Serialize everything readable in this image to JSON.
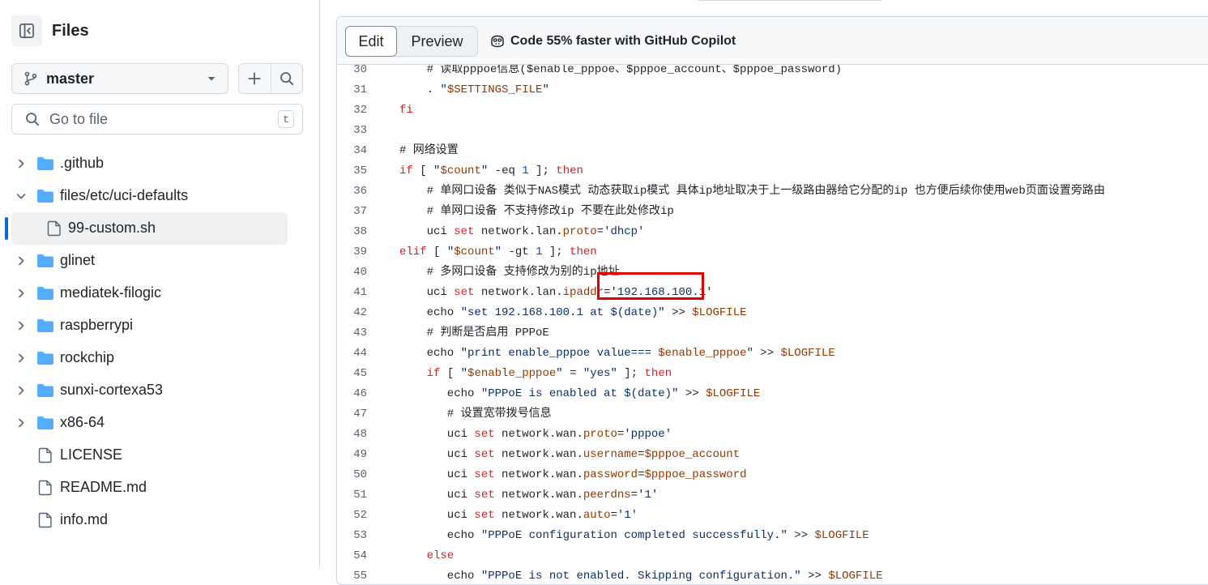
{
  "sidebar": {
    "title": "Files",
    "branch": "master",
    "goto_placeholder": "Go to file",
    "goto_shortcut": "t",
    "tree": [
      {
        "type": "dir",
        "label": ".github",
        "expanded": false,
        "indent": 0
      },
      {
        "type": "dir",
        "label": "files/etc/uci-defaults",
        "expanded": true,
        "indent": 0
      },
      {
        "type": "file",
        "label": "99-custom.sh",
        "selected": true,
        "indent": 1
      },
      {
        "type": "dir",
        "label": "glinet",
        "expanded": false,
        "indent": 0
      },
      {
        "type": "dir",
        "label": "mediatek-filogic",
        "expanded": false,
        "indent": 0
      },
      {
        "type": "dir",
        "label": "raspberrypi",
        "expanded": false,
        "indent": 0
      },
      {
        "type": "dir",
        "label": "rockchip",
        "expanded": false,
        "indent": 0
      },
      {
        "type": "dir",
        "label": "sunxi-cortexa53",
        "expanded": false,
        "indent": 0
      },
      {
        "type": "dir",
        "label": "x86-64",
        "expanded": false,
        "indent": 0
      },
      {
        "type": "file",
        "label": "LICENSE",
        "indent": 0
      },
      {
        "type": "file",
        "label": "README.md",
        "indent": 0
      },
      {
        "type": "file",
        "label": "info.md",
        "indent": 0
      }
    ]
  },
  "editor": {
    "tab_edit": "Edit",
    "tab_preview": "Preview",
    "copilot_text": "Code 55% faster with GitHub Copilot",
    "highlighted_value": "'192.168.100.1'"
  },
  "colors": {
    "accent": "#0969da",
    "folder": "#54aeff",
    "highlight_border": "#e00000"
  },
  "code_lines": [
    {
      "n": "30",
      "segs": [
        [
          "    ",
          "t"
        ],
        [
          "# 读取pppoe信息($enable_pppoe、$pppoe_account、$pppoe_password)",
          "cm"
        ]
      ]
    },
    {
      "n": "31",
      "segs": [
        [
          "    . ",
          "t"
        ],
        [
          "\"",
          "str"
        ],
        [
          "$SETTINGS_FILE",
          "var"
        ],
        [
          "\"",
          "str"
        ]
      ]
    },
    {
      "n": "32",
      "segs": [
        [
          "fi",
          "kw"
        ]
      ]
    },
    {
      "n": "33",
      "segs": [
        [
          "",
          "t"
        ]
      ]
    },
    {
      "n": "34",
      "segs": [
        [
          "# 网络设置",
          "cm"
        ]
      ]
    },
    {
      "n": "35",
      "segs": [
        [
          "if",
          "kw"
        ],
        [
          " [ ",
          "t"
        ],
        [
          "\"",
          "str"
        ],
        [
          "$count",
          "var"
        ],
        [
          "\"",
          "str"
        ],
        [
          " -eq ",
          "t"
        ],
        [
          "1",
          "ptn"
        ],
        [
          " ]; ",
          "t"
        ],
        [
          "then",
          "kw"
        ]
      ]
    },
    {
      "n": "36",
      "segs": [
        [
          "    # 单网口设备 类似于NAS模式 动态获取ip模式 具体ip地址取决于上一级路由器给它分配的ip 也方便后续你使用web页面设置旁路由",
          "cm"
        ]
      ]
    },
    {
      "n": "37",
      "segs": [
        [
          "    # 单网口设备 不支持修改ip 不要在此处修改ip",
          "cm"
        ]
      ]
    },
    {
      "n": "38",
      "segs": [
        [
          "    uci ",
          "t"
        ],
        [
          "set",
          "kw"
        ],
        [
          " network.lan.",
          "t"
        ],
        [
          "proto",
          "var"
        ],
        [
          "=",
          "t"
        ],
        [
          "'dhcp'",
          "str"
        ]
      ]
    },
    {
      "n": "39",
      "segs": [
        [
          "elif",
          "kw"
        ],
        [
          " [ ",
          "t"
        ],
        [
          "\"",
          "str"
        ],
        [
          "$count",
          "var"
        ],
        [
          "\"",
          "str"
        ],
        [
          " -gt ",
          "t"
        ],
        [
          "1",
          "ptn"
        ],
        [
          " ]; ",
          "t"
        ],
        [
          "then",
          "kw"
        ]
      ]
    },
    {
      "n": "40",
      "segs": [
        [
          "    # 多网口设备 支持修改为别的ip地址",
          "cm"
        ]
      ]
    },
    {
      "n": "41",
      "segs": [
        [
          "    uci ",
          "t"
        ],
        [
          "set",
          "kw"
        ],
        [
          " network.lan.",
          "t"
        ],
        [
          "ipaddr",
          "var"
        ],
        [
          "=",
          "t"
        ],
        [
          "'192.168.100.1'",
          "str"
        ]
      ]
    },
    {
      "n": "42",
      "segs": [
        [
          "    echo ",
          "t"
        ],
        [
          "\"set 192.168.100.1 at $(date)\"",
          "str"
        ],
        [
          " >> ",
          "t"
        ],
        [
          "$LOGFILE",
          "var"
        ]
      ]
    },
    {
      "n": "43",
      "segs": [
        [
          "    # 判断是否启用 PPPoE",
          "cm"
        ]
      ]
    },
    {
      "n": "44",
      "segs": [
        [
          "    echo ",
          "t"
        ],
        [
          "\"print enable_pppoe value=== ",
          "str"
        ],
        [
          "$enable_pppoe",
          "var"
        ],
        [
          "\"",
          "str"
        ],
        [
          " >> ",
          "t"
        ],
        [
          "$LOGFILE",
          "var"
        ]
      ]
    },
    {
      "n": "45",
      "segs": [
        [
          "    ",
          "t"
        ],
        [
          "if",
          "kw"
        ],
        [
          " [ ",
          "t"
        ],
        [
          "\"",
          "str"
        ],
        [
          "$enable_pppoe",
          "var"
        ],
        [
          "\"",
          "str"
        ],
        [
          " = ",
          "t"
        ],
        [
          "\"yes\"",
          "str"
        ],
        [
          " ]; ",
          "t"
        ],
        [
          "then",
          "kw"
        ]
      ]
    },
    {
      "n": "46",
      "segs": [
        [
          "       echo ",
          "t"
        ],
        [
          "\"PPPoE is enabled at $(date)\"",
          "str"
        ],
        [
          " >> ",
          "t"
        ],
        [
          "$LOGFILE",
          "var"
        ]
      ]
    },
    {
      "n": "47",
      "segs": [
        [
          "       # 设置宽带拨号信息",
          "cm"
        ]
      ]
    },
    {
      "n": "48",
      "segs": [
        [
          "       uci ",
          "t"
        ],
        [
          "set",
          "kw"
        ],
        [
          " network.wan.",
          "t"
        ],
        [
          "proto",
          "var"
        ],
        [
          "=",
          "t"
        ],
        [
          "'pppoe'",
          "str"
        ]
      ]
    },
    {
      "n": "49",
      "segs": [
        [
          "       uci ",
          "t"
        ],
        [
          "set",
          "kw"
        ],
        [
          " network.wan.",
          "t"
        ],
        [
          "username",
          "var"
        ],
        [
          "=",
          "t"
        ],
        [
          "$pppoe_account",
          "var"
        ]
      ]
    },
    {
      "n": "50",
      "segs": [
        [
          "       uci ",
          "t"
        ],
        [
          "set",
          "kw"
        ],
        [
          " network.wan.",
          "t"
        ],
        [
          "password",
          "var"
        ],
        [
          "=",
          "t"
        ],
        [
          "$pppoe_password",
          "var"
        ]
      ]
    },
    {
      "n": "51",
      "segs": [
        [
          "       uci ",
          "t"
        ],
        [
          "set",
          "kw"
        ],
        [
          " network.wan.",
          "t"
        ],
        [
          "peerdns",
          "var"
        ],
        [
          "=",
          "t"
        ],
        [
          "'1'",
          "str"
        ]
      ]
    },
    {
      "n": "52",
      "segs": [
        [
          "       uci ",
          "t"
        ],
        [
          "set",
          "kw"
        ],
        [
          " network.wan.",
          "t"
        ],
        [
          "auto",
          "var"
        ],
        [
          "=",
          "t"
        ],
        [
          "'1'",
          "str"
        ]
      ]
    },
    {
      "n": "53",
      "segs": [
        [
          "       echo ",
          "t"
        ],
        [
          "\"PPPoE configuration completed successfully.\"",
          "str"
        ],
        [
          " >> ",
          "t"
        ],
        [
          "$LOGFILE",
          "var"
        ]
      ]
    },
    {
      "n": "54",
      "segs": [
        [
          "    ",
          "t"
        ],
        [
          "else",
          "kw"
        ]
      ]
    },
    {
      "n": "55",
      "segs": [
        [
          "       echo ",
          "t"
        ],
        [
          "\"PPPoE is not enabled. Skipping configuration.\"",
          "str"
        ],
        [
          " >> ",
          "t"
        ],
        [
          "$LOGFILE",
          "var"
        ]
      ]
    }
  ]
}
